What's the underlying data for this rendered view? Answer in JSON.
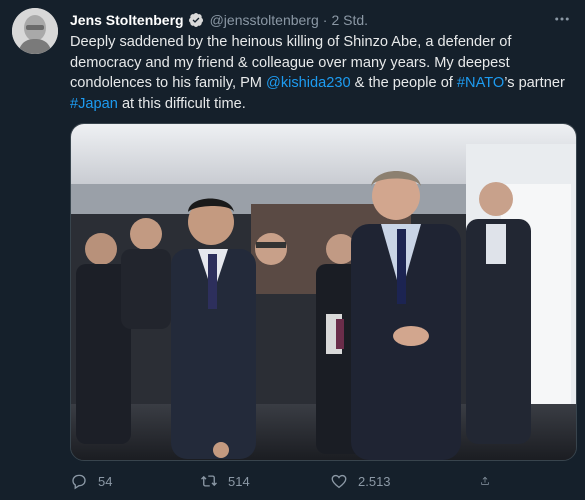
{
  "author": {
    "name": "Jens Stoltenberg",
    "handle": "@jensstoltenberg",
    "separator": "·",
    "time": "2 Std."
  },
  "tweet": {
    "text_1": "Deeply saddened by the heinous killing of Shinzo Abe, a defender of democracy and my friend & colleague over many years. My deepest condolences to his family, PM ",
    "mention": "@kishida230",
    "text_2": " & the people of ",
    "hashtag_1": "#NATO",
    "text_3": "’s partner ",
    "hashtag_2": "#Japan",
    "text_4": " at this difficult time."
  },
  "stats": {
    "replies": "54",
    "retweets": "514",
    "likes": "2.513"
  },
  "icons": {
    "verified": "verified-badge-icon",
    "more": "more-icon",
    "reply": "reply-icon",
    "retweet": "retweet-icon",
    "like": "heart-icon",
    "share": "share-icon"
  },
  "colors": {
    "background": "#15202b",
    "link": "#1d9bf0",
    "muted": "#8b98a5",
    "text": "#e7e9ea"
  }
}
